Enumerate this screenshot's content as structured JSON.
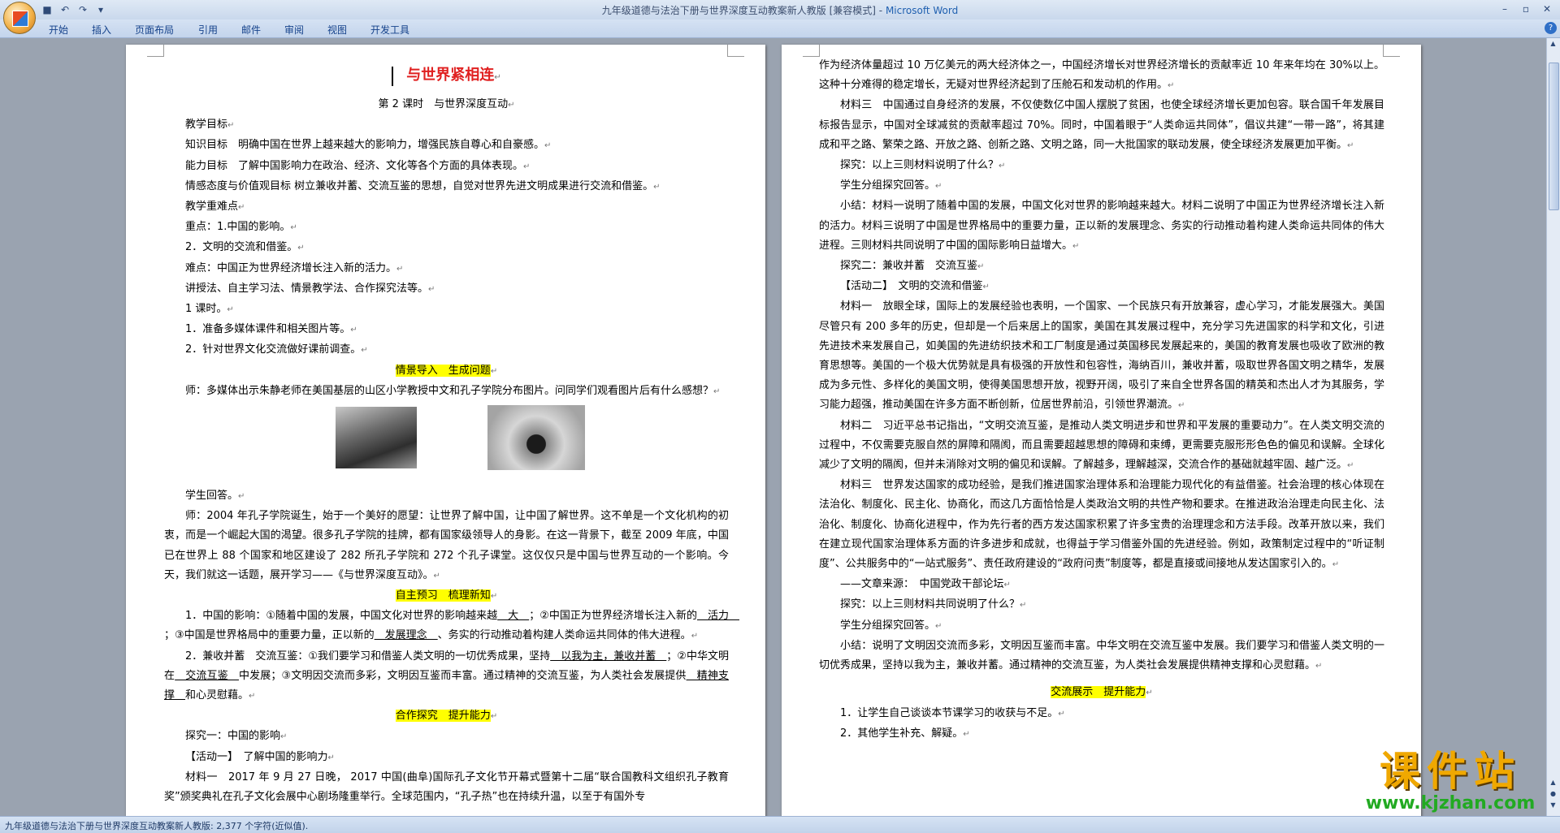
{
  "window": {
    "title": "九年级道德与法治下册与世界深度互动教案新人教版 [兼容模式]",
    "app_name": "Microsoft Word"
  },
  "ribbon": {
    "tabs": [
      "开始",
      "插入",
      "页面布局",
      "引用",
      "邮件",
      "审阅",
      "视图",
      "开发工具"
    ]
  },
  "status": {
    "text": "九年级道德与法治下册与世界深度互动教案新人教版: 2,377 个字符(近似值)."
  },
  "watermark": {
    "big": "课件站",
    "small": "www.kjzhan.com"
  },
  "page1": {
    "title": "与世界紧相连",
    "subtitle": "第 2 课时　与世界深度互动",
    "lines": [
      "教学目标",
      "知识目标　明确中国在世界上越来越大的影响力，增强民族自尊心和自豪感。",
      "能力目标　了解中国影响力在政治、经济、文化等各个方面的具体表现。",
      "情感态度与价值观目标 树立兼收并蓄、交流互鉴的思想，自觉对世界先进文明成果进行交流和借鉴。",
      "教学重难点",
      "重点：1.中国的影响。",
      "2．文明的交流和借鉴。",
      "难点：中国正为世界经济增长注入新的活力。",
      "讲授法、自主学习法、情景教学法、合作探究法等。",
      "1 课时。",
      "1．准备多媒体课件和相关图片等。",
      "2．针对世界文化交流做好课前调查。"
    ],
    "heading1": "情景导入　生成问题",
    "teacher1": "师：多媒体出示朱静老师在美国基层的山区小学教授中文和孔子学院分布图片。问同学们观看图片后有什么感想？",
    "student1": "学生回答。",
    "teacher2": "师：2004 年孔子学院诞生，始于一个美好的愿望：让世界了解中国，让中国了解世界。这不单是一个文化机构的初衷，而是一个崛起大国的渴望。很多孔子学院的挂牌，都有国家级领导人的身影。在这一背景下，截至 2009 年底，中国已在世界上 88 个国家和地区建设了 282 所孔子学院和 272 个孔子课堂。这仅仅只是中国与世界互动的一个影响。今天，我们就这一话题，展开学习——《与世界深度互动》。",
    "heading2": "自主预习　梳理新知",
    "q1": {
      "p1": "1．中国的影响：①随着中国的发展，中国文化对世界的影响越来越",
      "b1": "　大　",
      "p2": "；②中国正为世界经济增长注入新的",
      "b2": "　活力　",
      "p3": "；③中国是世界格局中的重要力量，正以新的",
      "b3": "　发展理念　",
      "p4": "、务实的行动推动着构建人类命运共同体的伟大进程。"
    },
    "q2": {
      "p1": "2．兼收并蓄　交流互鉴：①我们要学习和借鉴人类文明的一切优秀成果，坚持",
      "b1": "　以我为主，兼收并蓄　",
      "p2": "；②中华文明在",
      "b2": "　交流互鉴　",
      "p3": "中发展；③文明因交流而多彩，文明因互鉴而丰富。通过精神的交流互鉴，为人类社会发展提供",
      "b3": "　精神支撑　",
      "p4": "和心灵慰藉。"
    },
    "heading3": "合作探究　提升能力",
    "explore1": "探究一：中国的影响",
    "activity1": "【活动一】　了解中国的影响力",
    "material1": "材料一　2017 年 9 月 27 日晚， 2017 中国(曲阜)国际孔子文化节开幕式暨第十二届“联合国教科文组织孔子教育奖”颁奖典礼在孔子文化会展中心剧场隆重举行。全球范围内，“孔子热”也在持续升温，以至于有国外专"
  },
  "page2": {
    "p1": "作为经济体量超过 10 万亿美元的两大经济体之一，中国经济增长对世界经济增长的贡献率近 10 年来年均在 30%以上。这种十分难得的稳定增长，无疑对世界经济起到了压舱石和发动机的作用。",
    "p2": "材料三　中国通过自身经济的发展，不仅使数亿中国人摆脱了贫困，也使全球经济增长更加包容。联合国千年发展目标报告显示，中国对全球减贫的贡献率超过 70%。同时，中国着眼于“人类命运共同体”，倡议共建“一带一路”，将其建成和平之路、繁荣之路、开放之路、创新之路、文明之路，同一大批国家的联动发展，使全球经济发展更加平衡。",
    "p3": "探究：以上三则材料说明了什么？",
    "p4": "学生分组探究回答。",
    "p5": "小结：材料一说明了随着中国的发展，中国文化对世界的影响越来越大。材料二说明了中国正为世界经济增长注入新的活力。材料三说明了中国是世界格局中的重要力量，正以新的发展理念、务实的行动推动着构建人类命运共同体的伟大进程。三则材料共同说明了中国的国际影响日益增大。",
    "p6": "探究二：兼收并蓄　交流互鉴",
    "p7": "【活动二】　文明的交流和借鉴",
    "p8": "材料一　放眼全球，国际上的发展经验也表明，一个国家、一个民族只有开放兼容，虚心学习，才能发展强大。美国尽管只有 200 多年的历史，但却是一个后来居上的国家，美国在其发展过程中，充分学习先进国家的科学和文化，引进先进技术来发展自己，如美国的先进纺织技术和工厂制度是通过英国移民发展起来的，美国的教育发展也吸收了欧洲的教育思想等。美国的一个极大优势就是具有极强的开放性和包容性，海纳百川，兼收并蓄，吸取世界各国文明之精华，发展成为多元性、多样化的美国文明，使得美国思想开放，视野开阔，吸引了来自全世界各国的精英和杰出人才为其服务，学习能力超强，推动美国在许多方面不断创新，位居世界前沿，引领世界潮流。",
    "p9": "材料二　习近平总书记指出，“文明交流互鉴，是推动人类文明进步和世界和平发展的重要动力”。在人类文明交流的过程中，不仅需要克服自然的屏障和隔阂，而且需要超越思想的障碍和束缚，更需要克服形形色色的偏见和误解。全球化减少了文明的隔阂，但并未消除对文明的偏见和误解。了解越多，理解越深，交流合作的基础就越牢固、越广泛。",
    "p10": "材料三　世界发达国家的成功经验，是我们推进国家治理体系和治理能力现代化的有益借鉴。社会治理的核心体现在法治化、制度化、民主化、协商化，而这几方面恰恰是人类政治文明的共性产物和要求。在推进政治治理走向民主化、法治化、制度化、协商化进程中，作为先行者的西方发达国家积累了许多宝贵的治理理念和方法手段。改革开放以来，我们在建立现代国家治理体系方面的许多进步和成就，也得益于学习借鉴外国的先进经验。例如，政策制定过程中的“听证制度”、公共服务中的“一站式服务”、责任政府建设的“政府问责”制度等，都是直接或间接地从发达国家引入的。",
    "p11": "——文章来源：　中国党政干部论坛",
    "p12": "探究：以上三则材料共同说明了什么？",
    "p13": "学生分组探究回答。",
    "p14": "小结：说明了文明因交流而多彩，文明因互鉴而丰富。中华文明在交流互鉴中发展。我们要学习和借鉴人类文明的一切优秀成果，坚持以我为主，兼收并蓄。通过精神的交流互鉴，为人类社会发展提供精神支撑和心灵慰藉。",
    "heading": "交流展示　提升能力",
    "p15": "1．让学生自己谈谈本节课学习的收获与不足。",
    "p16": "2．其他学生补充、解疑。"
  }
}
